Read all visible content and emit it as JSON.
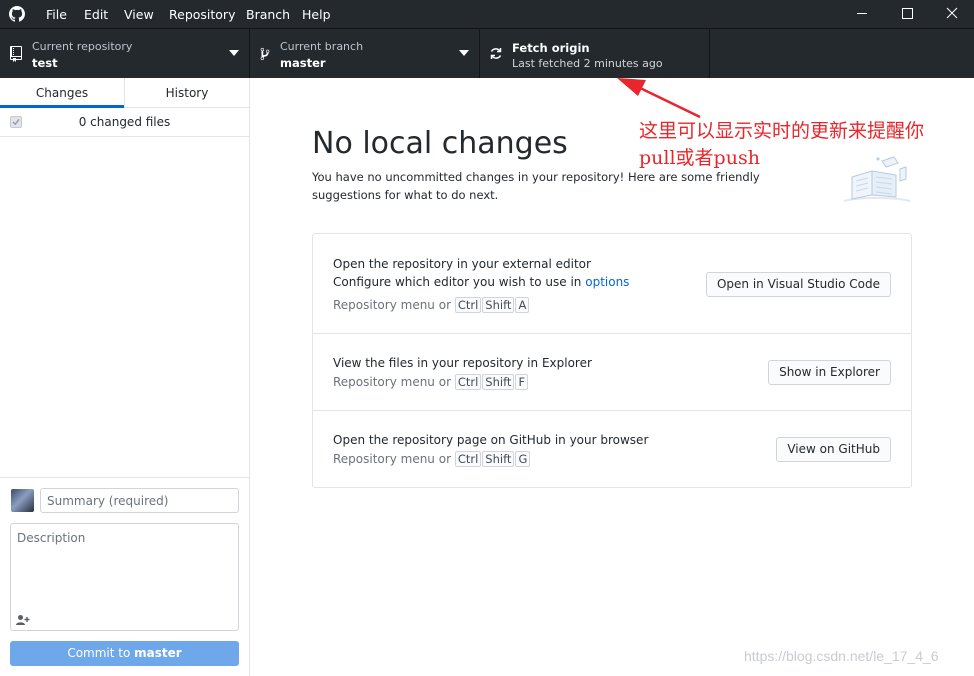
{
  "menu": {
    "items": [
      "File",
      "Edit",
      "View",
      "Repository",
      "Branch",
      "Help"
    ]
  },
  "toolbar": {
    "repository": {
      "sub": "Current repository",
      "value": "test"
    },
    "branch": {
      "sub": "Current branch",
      "value": "master"
    },
    "fetch": {
      "title": "Fetch origin",
      "sub": "Last fetched 2 minutes ago"
    }
  },
  "sidebar": {
    "tabs": [
      "Changes",
      "History"
    ],
    "changed_files": "0 changed files",
    "summary_placeholder": "Summary (required)",
    "description_placeholder": "Description",
    "commit_prefix": "Commit to ",
    "commit_branch": "master"
  },
  "main": {
    "heading": "No local changes",
    "intro": "You have no uncommitted changes in your repository! Here are some friendly suggestions for what to do next.",
    "suggestions": [
      {
        "title": "Open the repository in your external editor",
        "desc_prefix": "Configure which editor you wish to use in ",
        "desc_link": "options",
        "shortcut_prefix": "Repository menu or",
        "keys": [
          "Ctrl",
          "Shift",
          "A"
        ],
        "button": "Open in Visual Studio Code"
      },
      {
        "title": "View the files in your repository in Explorer",
        "shortcut_prefix": "Repository menu or",
        "keys": [
          "Ctrl",
          "Shift",
          "F"
        ],
        "button": "Show in Explorer"
      },
      {
        "title": "Open the repository page on GitHub in your browser",
        "shortcut_prefix": "Repository menu or",
        "keys": [
          "Ctrl",
          "Shift",
          "G"
        ],
        "button": "View on GitHub"
      }
    ]
  },
  "annotation": {
    "line1": "这里可以显示实时的更新来提醒你",
    "line2": "pull或者push",
    "color": "#e8262b"
  },
  "watermark": "https://blog.csdn.net/le_17_4_6",
  "colors": {
    "accent": "#0366d6",
    "toolbar_bg": "#24292e",
    "commit_button": "#6ea7ea"
  }
}
